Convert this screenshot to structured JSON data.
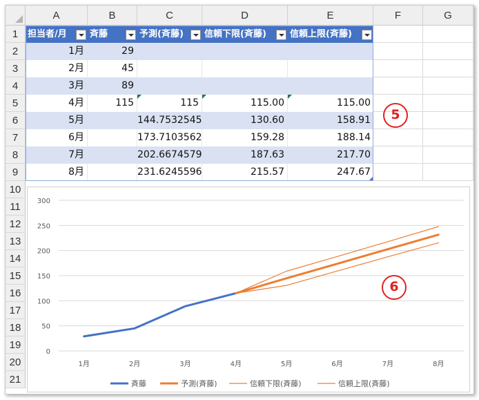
{
  "columns": [
    "A",
    "B",
    "C",
    "D",
    "E",
    "F",
    "G"
  ],
  "rows": [
    "1",
    "2",
    "3",
    "4",
    "5",
    "6",
    "7",
    "8",
    "9",
    "10",
    "11",
    "12",
    "13",
    "14",
    "15",
    "16",
    "17",
    "18",
    "19",
    "20",
    "21"
  ],
  "table": {
    "headers": [
      "担当者/月",
      "斉藤",
      "予測(斉藤)",
      "信頼下限(斉藤)",
      "信頼上限(斉藤)"
    ],
    "rows": [
      [
        "1月",
        "29",
        "",
        "",
        ""
      ],
      [
        "2月",
        "45",
        "",
        "",
        ""
      ],
      [
        "3月",
        "89",
        "",
        "",
        ""
      ],
      [
        "4月",
        "115",
        "115",
        "115.00",
        "115.00"
      ],
      [
        "5月",
        "",
        "144.7532545",
        "130.60",
        "158.91"
      ],
      [
        "6月",
        "",
        "173.7103562",
        "159.28",
        "188.14"
      ],
      [
        "7月",
        "",
        "202.6674579",
        "187.63",
        "217.70"
      ],
      [
        "8月",
        "",
        "231.6245596",
        "215.57",
        "247.67"
      ]
    ]
  },
  "annotations": {
    "badge5": "5",
    "badge6": "6"
  },
  "colors": {
    "actual": "#4472c4",
    "forecast": "#ed7d31",
    "band": "#d9e1f2",
    "header": "#4472c4",
    "badge": "#e02020"
  },
  "chart_data": {
    "type": "line",
    "categories": [
      "1月",
      "2月",
      "3月",
      "4月",
      "5月",
      "6月",
      "7月",
      "8月"
    ],
    "ylim": [
      0,
      300
    ],
    "yticks": [
      0,
      50,
      100,
      150,
      200,
      250,
      300
    ],
    "grid": true,
    "legend_position": "bottom",
    "series": [
      {
        "name": "斉藤",
        "values": [
          29,
          45,
          89,
          115,
          null,
          null,
          null,
          null
        ],
        "color": "#4472c4",
        "width": "thick"
      },
      {
        "name": "予測(斉藤)",
        "values": [
          null,
          null,
          null,
          115,
          144.7532545,
          173.7103562,
          202.6674579,
          231.6245596
        ],
        "color": "#ed7d31",
        "width": "thick"
      },
      {
        "name": "信頼下限(斉藤)",
        "values": [
          null,
          null,
          null,
          115,
          130.6,
          159.28,
          187.63,
          215.57
        ],
        "color": "#ed7d31",
        "width": "thin"
      },
      {
        "name": "信頼上限(斉藤)",
        "values": [
          null,
          null,
          null,
          115,
          158.91,
          188.14,
          217.7,
          247.67
        ],
        "color": "#ed7d31",
        "width": "thin"
      }
    ]
  }
}
